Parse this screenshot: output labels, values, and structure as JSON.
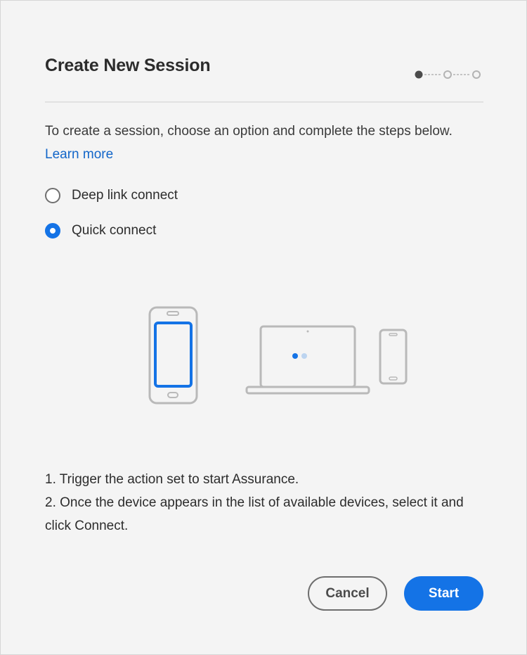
{
  "dialog": {
    "title": "Create New Session",
    "stepper": {
      "total_steps": 3,
      "current_step": 1
    },
    "intro_text": "To create a session, choose an option and complete the steps below.",
    "learn_more_label": "Learn more",
    "options": [
      {
        "label": "Deep link connect",
        "selected": false
      },
      {
        "label": "Quick connect",
        "selected": true
      }
    ],
    "instructions": [
      "1. Trigger the action set to start Assurance.",
      "2. Once the device appears in the list of available devices, select it and click Connect."
    ],
    "cancel_label": "Cancel",
    "start_label": "Start"
  },
  "colors": {
    "accent": "#1473e6",
    "link": "#1366c9",
    "background": "#f4f4f4"
  },
  "icons": [
    "radio-unchecked-icon",
    "radio-checked-icon",
    "phone-icon",
    "laptop-icon",
    "small-phone-icon",
    "loading-dots-icon"
  ]
}
